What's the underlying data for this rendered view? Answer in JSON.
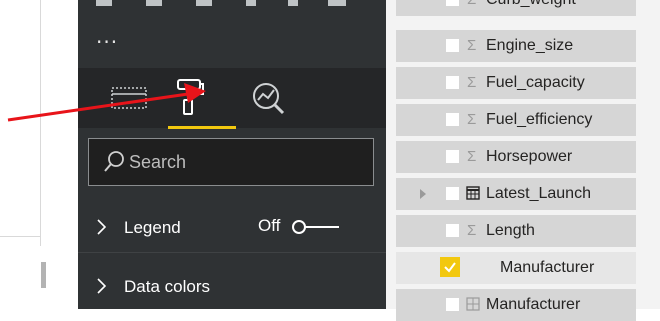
{
  "visualizations_pane": {
    "overflow_label": "...",
    "tabs": [
      {
        "name": "fields",
        "icon": "fields-icon"
      },
      {
        "name": "format",
        "icon": "paint-roller-icon",
        "active": true
      },
      {
        "name": "analytics",
        "icon": "analytics-icon"
      }
    ],
    "search": {
      "placeholder": "Search"
    },
    "sections": {
      "legend": {
        "label": "Legend",
        "toggle_state": "Off"
      },
      "data_colors": {
        "label": "Data colors"
      }
    }
  },
  "fields_list": {
    "items": [
      {
        "label": "Curb_weight",
        "type": "Σ",
        "checked": false
      },
      {
        "label": "Engine_size",
        "type": "Σ",
        "checked": false
      },
      {
        "label": "Fuel_capacity",
        "type": "Σ",
        "checked": false
      },
      {
        "label": "Fuel_efficiency",
        "type": "Σ",
        "checked": false
      },
      {
        "label": "Horsepower",
        "type": "Σ",
        "checked": false
      },
      {
        "label": "Latest_Launch",
        "type": "calendar-icon",
        "checked": false
      },
      {
        "label": "Length",
        "type": "Σ",
        "checked": false
      },
      {
        "label": "Manufacturer",
        "type": "",
        "checked": true
      },
      {
        "label": "Manufacturer",
        "type": "hierarchy-icon",
        "checked": false
      }
    ]
  },
  "colors": {
    "pane_bg": "#2f3234",
    "accent": "#f2c80f",
    "annotation_arrow": "#e8141a"
  }
}
